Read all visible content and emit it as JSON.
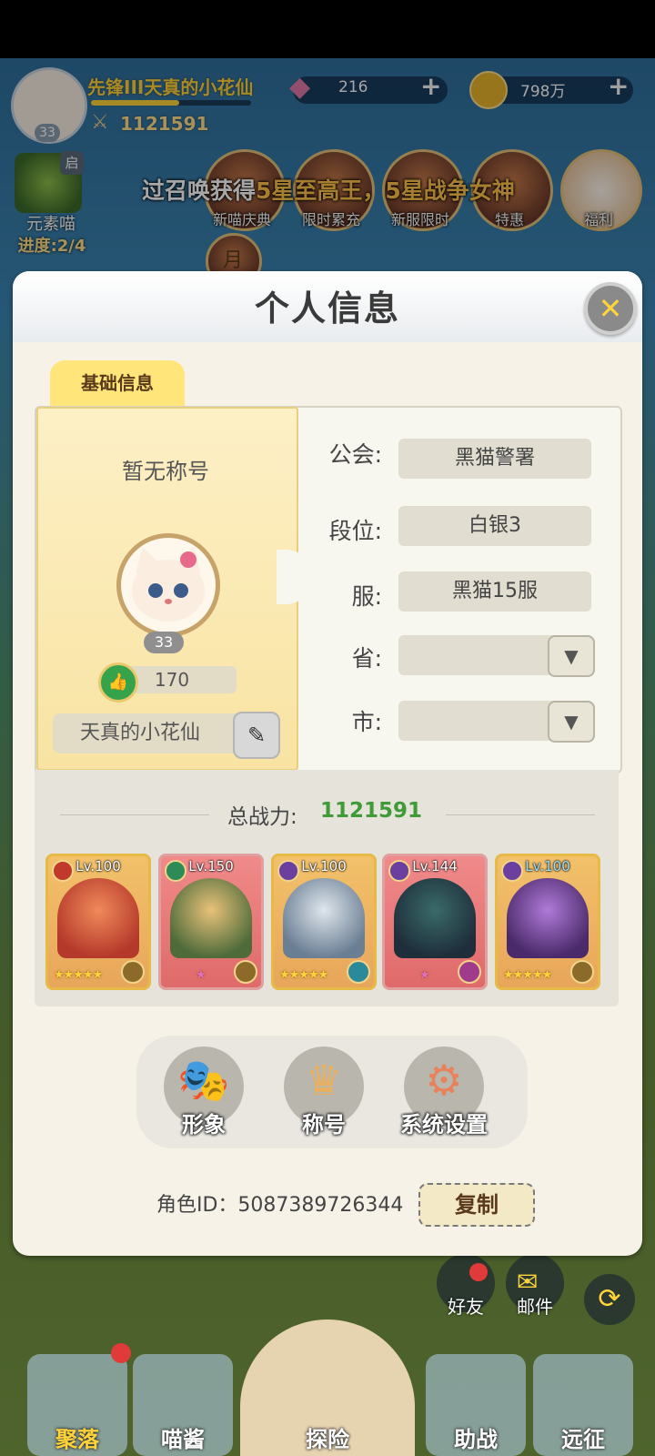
{
  "hud": {
    "player_title": "先锋III天真的小花仙",
    "player_level": "33",
    "combat_power": "1121591",
    "gems": "216",
    "gold": "798万",
    "plus": "+"
  },
  "banner": {
    "marquee_a": "过召唤获得",
    "marquee_b": "5星至高王，5星战争女神"
  },
  "side_event": {
    "name": "元素喵",
    "progress": "进度:2/4",
    "badge": "启"
  },
  "event_icons": [
    {
      "label": "新喵庆典"
    },
    {
      "label": "限时累充"
    },
    {
      "label": "新服限时"
    },
    {
      "label": "特惠"
    },
    {
      "label": "福利"
    }
  ],
  "event_icons_row2": [
    {
      "label": "月"
    }
  ],
  "dialog": {
    "title": "个人信息",
    "close_glyph": "✕",
    "tab_label": "基础信息"
  },
  "profile": {
    "no_title": "暂无称号",
    "level": "33",
    "likes": "170",
    "name": "天真的小花仙"
  },
  "fields": [
    {
      "label": "公会:",
      "value": "黑猫警署"
    },
    {
      "label": "段位:",
      "value": "白银3"
    },
    {
      "label": "服:",
      "value": "黑猫15服"
    },
    {
      "label": "省:",
      "value": ""
    },
    {
      "label": "市:",
      "value": ""
    }
  ],
  "power": {
    "label": "总战力:",
    "value": "1121591"
  },
  "heroes": [
    {
      "level": "Lv.100",
      "stars": "★★★★★",
      "star_count": 5
    },
    {
      "level": "Lv.150",
      "stars": "★",
      "star_count": 1
    },
    {
      "level": "Lv.100",
      "stars": "★★★★★",
      "star_count": 5
    },
    {
      "level": "Lv.144",
      "stars": "★",
      "star_count": 1
    },
    {
      "level": "Lv.100",
      "stars": "★★★★★",
      "star_count": 5
    }
  ],
  "menu": [
    {
      "label": "形象"
    },
    {
      "label": "称号"
    },
    {
      "label": "系统设置"
    }
  ],
  "role": {
    "id_text": "角色ID：5087389726344",
    "copy_label": "复制"
  },
  "bottom_side": {
    "friends": "好友",
    "mail": "邮件"
  },
  "nav": [
    {
      "label": "聚落"
    },
    {
      "label": "喵酱"
    },
    {
      "label": "探险"
    },
    {
      "label": "助战"
    },
    {
      "label": "远征"
    }
  ],
  "colors": {
    "accent_gold": "#ffd43b",
    "power_green": "#3f9a38",
    "tab_yellow": "#ffe57a"
  }
}
